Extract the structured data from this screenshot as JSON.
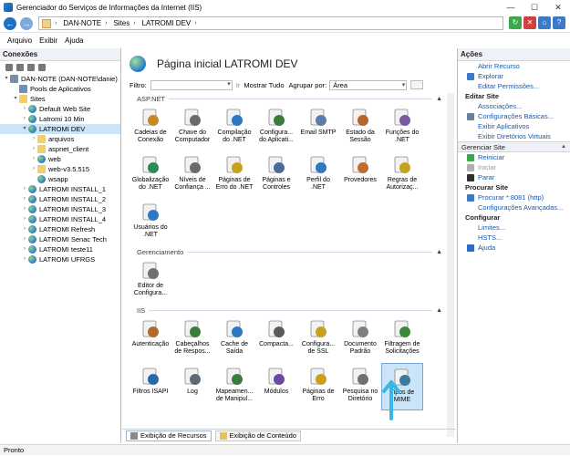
{
  "window": {
    "title": "Gerenciador do Serviços de Informações da Internet (IIS)",
    "status": "Pronto"
  },
  "address": {
    "crumbs": [
      "DAN-NOTE",
      "Sites",
      "LATROMI DEV"
    ]
  },
  "menu": [
    "Arquivo",
    "Exibir",
    "Ajuda"
  ],
  "connections": {
    "header": "Conexões",
    "tree": [
      {
        "label": "DAN-NOTE (DAN-NOTE\\danie)",
        "icon": "server-icon",
        "indent": 0,
        "exp": "▾"
      },
      {
        "label": "Pools de Aplicativos",
        "icon": "app-pool-icon",
        "indent": 1,
        "exp": ""
      },
      {
        "label": "Sites",
        "icon": "sites-folder-icon",
        "indent": 1,
        "exp": "▾"
      },
      {
        "label": "Default Web Site",
        "icon": "globe-icon",
        "indent": 2,
        "exp": "›"
      },
      {
        "label": "Latromi 10 Min",
        "icon": "globe-icon",
        "indent": 2,
        "exp": "›"
      },
      {
        "label": "LATROMI DEV",
        "icon": "globe-icon",
        "indent": 2,
        "exp": "▾",
        "selected": true
      },
      {
        "label": "arquivos",
        "icon": "folder-icon",
        "indent": 3,
        "exp": "›"
      },
      {
        "label": "aspnet_client",
        "icon": "folder-icon",
        "indent": 3,
        "exp": "›"
      },
      {
        "label": "web",
        "icon": "globe-icon",
        "indent": 3,
        "exp": "›"
      },
      {
        "label": "web-v3.5.515",
        "icon": "folder-icon",
        "indent": 3,
        "exp": "›"
      },
      {
        "label": "wsapp",
        "icon": "globe-icon",
        "indent": 3,
        "exp": ""
      },
      {
        "label": "LATROMI INSTALL_1",
        "icon": "globe-icon",
        "indent": 2,
        "exp": "›"
      },
      {
        "label": "LATROMI INSTALL_2",
        "icon": "globe-icon",
        "indent": 2,
        "exp": "›"
      },
      {
        "label": "LATROMI INSTALL_3",
        "icon": "globe-icon",
        "indent": 2,
        "exp": "›"
      },
      {
        "label": "LATROMI INSTALL_4",
        "icon": "globe-icon",
        "indent": 2,
        "exp": "›"
      },
      {
        "label": "LATROMI Refresh",
        "icon": "globe-icon",
        "indent": 2,
        "exp": "›"
      },
      {
        "label": "LATROMI Senac Tech",
        "icon": "globe-icon",
        "indent": 2,
        "exp": "›"
      },
      {
        "label": "LATROMI teste11",
        "icon": "globe-icon",
        "indent": 2,
        "exp": "›"
      },
      {
        "label": "LATROMI UFRGS",
        "icon": "globe-icon",
        "indent": 2,
        "exp": "›"
      }
    ]
  },
  "main": {
    "title": "Página inicial LATROMI DEV",
    "filter_label": "Filtro:",
    "ir_label": "Ir",
    "show_all": "Mostrar Tudo",
    "group_label": "Agrupar por:",
    "group_value": "Área",
    "groups": [
      {
        "name": "ASP.NET",
        "items": [
          {
            "l1": "Cadeias de",
            "l2": "Conexão",
            "icon": "connection-strings-icon",
            "color": "#c48a2a"
          },
          {
            "l1": "Chave do",
            "l2": "Computador",
            "icon": "machine-key-icon",
            "color": "#6a6a6a"
          },
          {
            "l1": "Compilação",
            "l2": "do .NET",
            "icon": "compilation-icon",
            "color": "#2f78c4"
          },
          {
            "l1": "Configura...",
            "l2": "do Aplicati...",
            "icon": "app-settings-icon",
            "color": "#3a7d3a"
          },
          {
            "l1": "Email SMTP",
            "l2": "",
            "icon": "smtp-email-icon",
            "color": "#5a7fa8"
          },
          {
            "l1": "Estado da",
            "l2": "Sessão",
            "icon": "session-state-icon",
            "color": "#b5642a"
          },
          {
            "l1": "Funções do",
            "l2": ".NET",
            "icon": "net-roles-icon",
            "color": "#7a5aa0"
          },
          {
            "l1": "Globalização",
            "l2": "do .NET",
            "icon": "globalization-icon",
            "color": "#2a8a5a"
          },
          {
            "l1": "Níveis de",
            "l2": "Confiança ...",
            "icon": "trust-levels-icon",
            "color": "#6a6a6a"
          },
          {
            "l1": "Páginas de",
            "l2": "Erro do .NET",
            "icon": "error-pages-net-icon",
            "color": "#c8a020"
          },
          {
            "l1": "Páginas e",
            "l2": "Controles",
            "icon": "pages-controls-icon",
            "color": "#4a6a9a"
          },
          {
            "l1": "Perfil do",
            "l2": ".NET",
            "icon": "net-profile-icon",
            "color": "#2f78c4"
          },
          {
            "l1": "Provedores",
            "l2": "",
            "icon": "providers-icon",
            "color": "#c06a30"
          },
          {
            "l1": "Regras de",
            "l2": "Autorizaç...",
            "icon": "authorization-rules-icon",
            "color": "#c8a020"
          },
          {
            "l1": "Usuários do",
            "l2": ".NET",
            "icon": "net-users-icon",
            "color": "#2f78c4"
          }
        ]
      },
      {
        "name": "Gerenciamento",
        "items": [
          {
            "l1": "Editor de",
            "l2": "Configura...",
            "icon": "config-editor-icon",
            "color": "#707070"
          }
        ]
      },
      {
        "name": "IIS",
        "items": [
          {
            "l1": "Autenticação",
            "l2": "",
            "icon": "authentication-icon",
            "color": "#b06a2a"
          },
          {
            "l1": "Cabeçalhos",
            "l2": "de Respos...",
            "icon": "response-headers-icon",
            "color": "#3a7d3a"
          },
          {
            "l1": "Cache de",
            "l2": "Saída",
            "icon": "output-cache-icon",
            "color": "#2f78c4"
          },
          {
            "l1": "Compacta...",
            "l2": "",
            "icon": "compression-icon",
            "color": "#5a5a5a"
          },
          {
            "l1": "Configura...",
            "l2": "de SSL",
            "icon": "ssl-settings-icon",
            "color": "#c8a020"
          },
          {
            "l1": "Documento",
            "l2": "Padrão",
            "icon": "default-document-icon",
            "color": "#808080"
          },
          {
            "l1": "Filtragem de",
            "l2": "Solicitações",
            "icon": "request-filtering-icon",
            "color": "#3a8a3a"
          },
          {
            "l1": "Filtros ISAPI",
            "l2": "",
            "icon": "isapi-filters-icon",
            "color": "#2a6aa8"
          },
          {
            "l1": "Log",
            "l2": "",
            "icon": "logging-icon",
            "color": "#5a6a7a"
          },
          {
            "l1": "Mapeamen...",
            "l2": "de Manipul...",
            "icon": "handler-mappings-icon",
            "color": "#3a7d3a"
          },
          {
            "l1": "Módulos",
            "l2": "",
            "icon": "modules-icon",
            "color": "#6a4aa0"
          },
          {
            "l1": "Páginas de",
            "l2": "Erro",
            "icon": "error-pages-icon",
            "color": "#c8a020"
          },
          {
            "l1": "Pesquisa no",
            "l2": "Diretório",
            "icon": "directory-browsing-icon",
            "color": "#707070"
          },
          {
            "l1": "Tipos de",
            "l2": "MIME",
            "icon": "mime-types-icon",
            "color": "#3a7a9a",
            "selected": true
          }
        ]
      }
    ],
    "tabs": [
      "Exibição de Recursos",
      "Exibição de Conteúdo"
    ]
  },
  "actions": {
    "header": "Ações",
    "items": [
      {
        "t": "link",
        "label": "Abrir Recurso",
        "icon": ""
      },
      {
        "t": "link",
        "label": "Explorar",
        "icon": "explore-icon"
      },
      {
        "t": "link",
        "label": "Editar Permissões...",
        "icon": ""
      },
      {
        "t": "sect",
        "label": "Editar Site",
        "icon": ""
      },
      {
        "t": "link",
        "label": "Associações...",
        "icon": ""
      },
      {
        "t": "link",
        "label": "Configurações Básicas...",
        "icon": "basic-settings-icon"
      },
      {
        "t": "link",
        "label": "Exibir Aplicativos",
        "icon": ""
      },
      {
        "t": "link",
        "label": "Exibir Diretórios Virtuais",
        "icon": ""
      },
      {
        "t": "bar",
        "label": "Gerenciar Site",
        "icon": ""
      },
      {
        "t": "link",
        "label": "Reiniciar",
        "icon": "restart-icon"
      },
      {
        "t": "dis",
        "label": "Iniciar",
        "icon": "start-icon"
      },
      {
        "t": "link",
        "label": "Parar",
        "icon": "stop-icon"
      },
      {
        "t": "sect",
        "label": "Procurar Site",
        "icon": ""
      },
      {
        "t": "link",
        "label": "Procurar *:8081 (http)",
        "icon": "browse-icon"
      },
      {
        "t": "link",
        "label": "Configurações Avançadas...",
        "icon": ""
      },
      {
        "t": "sect",
        "label": "Configurar",
        "icon": ""
      },
      {
        "t": "link",
        "label": "Limites...",
        "icon": ""
      },
      {
        "t": "link",
        "label": "HSTS...",
        "icon": ""
      },
      {
        "t": "link",
        "label": "Ajuda",
        "icon": "help-icon"
      }
    ]
  }
}
